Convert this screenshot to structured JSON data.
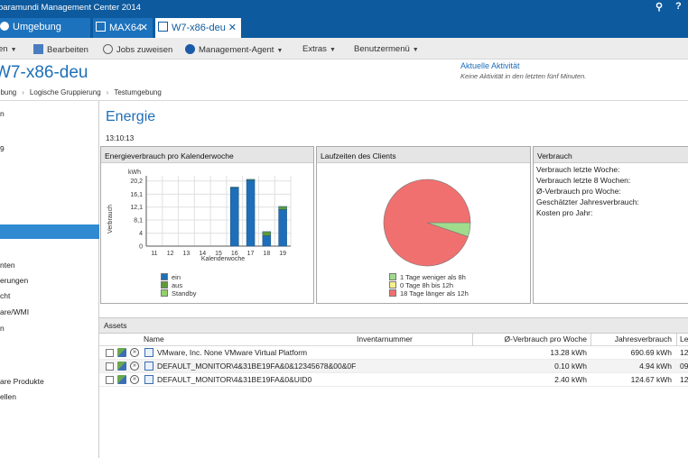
{
  "titlebar": {
    "title": "baramundi Management Center 2014",
    "search_icon": "search-icon",
    "help_label": "?"
  },
  "tabs": [
    {
      "label": "Umgebung"
    },
    {
      "label": "MAX64",
      "close": "✕"
    },
    {
      "label": "W7-x86-deu",
      "close": "✕"
    }
  ],
  "toolbar": {
    "item0": "en",
    "item1": "Bearbeiten",
    "item2": "Jobs zuweisen",
    "item3": "Management-Agent",
    "item4": "Extras",
    "item5": "Benutzermenü"
  },
  "header": {
    "title": "W7-x86-deu",
    "breadcrumb": [
      "ebung",
      "Logische Gruppierung",
      "Testumgebung"
    ],
    "activity_title": "Aktuelle Aktivität",
    "activity_text": "Keine Aktivität in den letzten fünf Minuten."
  },
  "sidebar": {
    "items": [
      "n",
      "9",
      "nten",
      "erungen",
      "cht",
      "are/WMI",
      "n",
      "are Produkte",
      "ellen"
    ]
  },
  "main": {
    "title": "Energie",
    "timestamp": "13:10:13"
  },
  "panels": {
    "energy": {
      "title": "Energieverbrauch pro Kalenderwoche",
      "ylabel": "Verbrauch",
      "unit": "kWh",
      "xlabel": "Kalenderwoche",
      "legend": [
        "ein",
        "aus",
        "Standby"
      ]
    },
    "runtime": {
      "title": "Laufzeiten des Clients",
      "legend": [
        "1 Tage weniger als 8h",
        "0 Tage 8h bis 12h",
        "18 Tage länger als 12h"
      ]
    },
    "usage": {
      "title": "Verbrauch",
      "rows": [
        "Verbrauch letzte Woche:",
        "Verbrauch letzte 8 Wochen:",
        "Ø-Verbrauch pro Woche:",
        "Geschätzter Jahresverbrauch:",
        "Kosten pro Jahr:"
      ]
    }
  },
  "assets": {
    "title": "Assets",
    "columns": [
      "Name",
      "Inventarnummer",
      "Ø-Verbrauch pro Woche",
      "Jahresverbrauch",
      "Le"
    ],
    "rows": [
      {
        "name": "VMware, Inc. None VMware Virtual Platform",
        "inv": "",
        "week": "13.28 kWh",
        "year": "690.69 kWh",
        "last": "12."
      },
      {
        "name": "DEFAULT_MONITOR\\4&31BE19FA&0&12345678&00&0F",
        "inv": "",
        "week": "0.10 kWh",
        "year": "4.94 kWh",
        "last": "09."
      },
      {
        "name": "DEFAULT_MONITOR\\4&31BE19FA&0&UID0",
        "inv": "",
        "week": "2.40 kWh",
        "year": "124.67 kWh",
        "last": "12."
      }
    ]
  },
  "colors": {
    "accent": "#1d6fb8",
    "titlebar": "#0d5a9e",
    "bar_on": "#1f6fb8",
    "bar_off": "#5e9a3a",
    "bar_standby": "#8fd16a",
    "pie_long": "#f07070",
    "pie_short": "#9fdc8c",
    "pie_mid": "#f5f08a"
  },
  "chart_data": [
    {
      "type": "bar",
      "title": "Energieverbrauch pro Kalenderwoche",
      "xlabel": "Kalenderwoche",
      "ylabel": "Verbrauch",
      "unit": "kWh",
      "categories": [
        "11",
        "12",
        "13",
        "14",
        "15",
        "16",
        "17",
        "18",
        "19"
      ],
      "yticks": [
        "0",
        "4",
        "8,1",
        "12,1",
        "16,1",
        "20,2"
      ],
      "ylim": [
        0,
        21.8
      ],
      "series": [
        {
          "name": "ein",
          "values": [
            0,
            0,
            0,
            0,
            0,
            18.2,
            20.4,
            3.2,
            11.3
          ]
        },
        {
          "name": "aus",
          "values": [
            0,
            0,
            0,
            0,
            0,
            0.1,
            0.3,
            1.3,
            1.0
          ]
        },
        {
          "name": "Standby",
          "values": [
            0,
            0,
            0,
            0,
            0,
            0,
            0,
            0,
            0
          ]
        }
      ],
      "stacked": true,
      "grid": true,
      "legend": "bottom"
    },
    {
      "type": "pie",
      "title": "Laufzeiten des Clients",
      "labels": [
        "1 Tage weniger als 8h",
        "0 Tage 8h bis 12h",
        "18 Tage länger als 12h"
      ],
      "values": [
        1,
        0,
        18
      ],
      "legend": "bottom"
    }
  ]
}
